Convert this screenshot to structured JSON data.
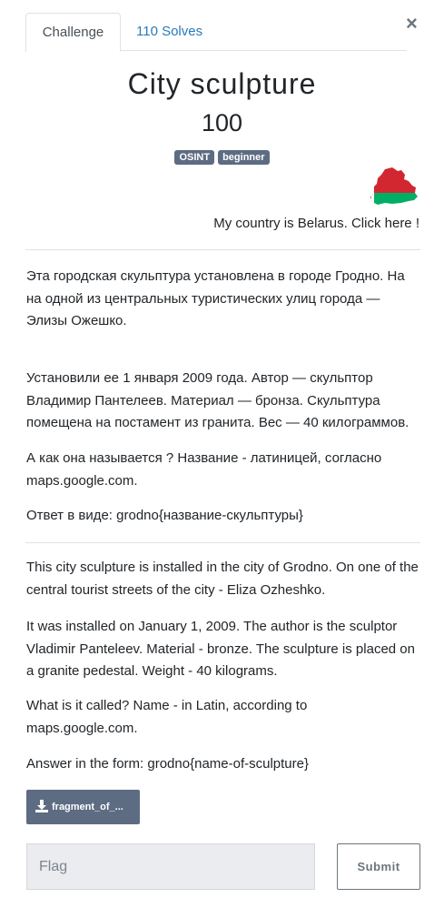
{
  "tabs": {
    "challenge": "Challenge",
    "solves": "110 Solves"
  },
  "close_label": "×",
  "challenge": {
    "title": "City sculpture",
    "points": "100",
    "tags": [
      "OSINT",
      "beginner"
    ],
    "country_text": "My country is Belarus. Click here !"
  },
  "description_ru": [
    "Эта городская скульптура установлена в городе Гродно. На на одной из центральных туристических улиц города — Элизы Ожешко.",
    "Установили ее 1 января 2009 года. Автор — скульптор Владимир Пантелеев. Материал — бронза. Скульптура помещена на постамент из гранита. Вес — 40 килограммов.",
    "А как она называется ? Название - латиницей, согласно maps.google.com.",
    "Ответ в виде: grodno{название-скульптуры}"
  ],
  "description_en": [
    "This city sculpture is installed in the city of Grodno. On one of the central tourist streets of the city - Eliza Ozheshko.",
    "It was installed on January 1, 2009. The author is the sculptor Vladimir Panteleev. Material - bronze. The sculpture is placed on a granite pedestal. Weight - 40 kilograms.",
    "What is it called? Name - in Latin, according to maps.google.com.",
    "Answer in the form: grodno{name-of-sculpture}"
  ],
  "file_button": "fragment_of_...",
  "form": {
    "flag_placeholder": "Flag",
    "submit_label": "Submit"
  },
  "colors": {
    "link": "#2a7ab8",
    "badge": "#5d6c82",
    "flag_red": "#d22730",
    "flag_green": "#00af66"
  }
}
